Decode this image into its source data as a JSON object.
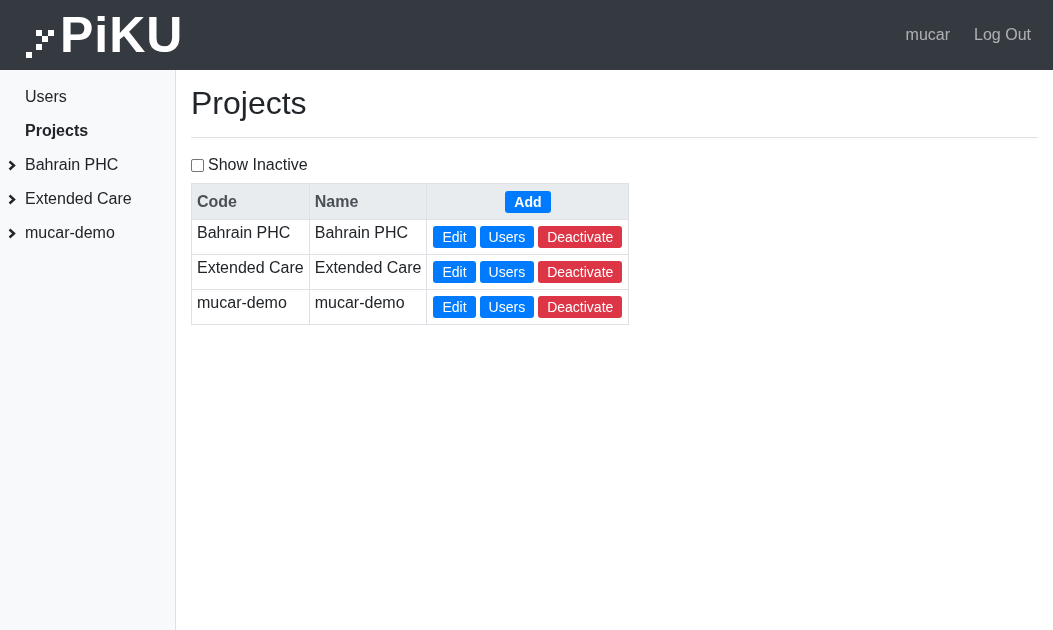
{
  "header": {
    "logo": "PiKU",
    "nav": [
      "mucar",
      "Log Out"
    ]
  },
  "sidebar": {
    "items": [
      {
        "label": "Users",
        "kind": "link",
        "selected": false
      },
      {
        "label": "Projects",
        "kind": "link",
        "selected": true
      },
      {
        "label": "Bahrain PHC",
        "kind": "group",
        "expanded": false
      },
      {
        "label": "Extended Care",
        "kind": "group",
        "expanded": false
      },
      {
        "label": "mucar-demo",
        "kind": "group",
        "expanded": false
      }
    ]
  },
  "page": {
    "title": "Projects",
    "show_inactive": {
      "label": "Show Inactive",
      "checked": false
    },
    "table": {
      "columns": [
        "Code",
        "Name"
      ],
      "add_button": "Add",
      "rows": [
        {
          "code": "Bahrain PHC",
          "name": "Bahrain PHC",
          "actions": [
            "Edit",
            "Users",
            "Deactivate"
          ]
        },
        {
          "code": "Extended Care",
          "name": "Extended Care",
          "actions": [
            "Edit",
            "Users",
            "Deactivate"
          ]
        },
        {
          "code": "mucar-demo",
          "name": "mucar-demo",
          "actions": [
            "Edit",
            "Users",
            "Deactivate"
          ]
        }
      ]
    }
  }
}
